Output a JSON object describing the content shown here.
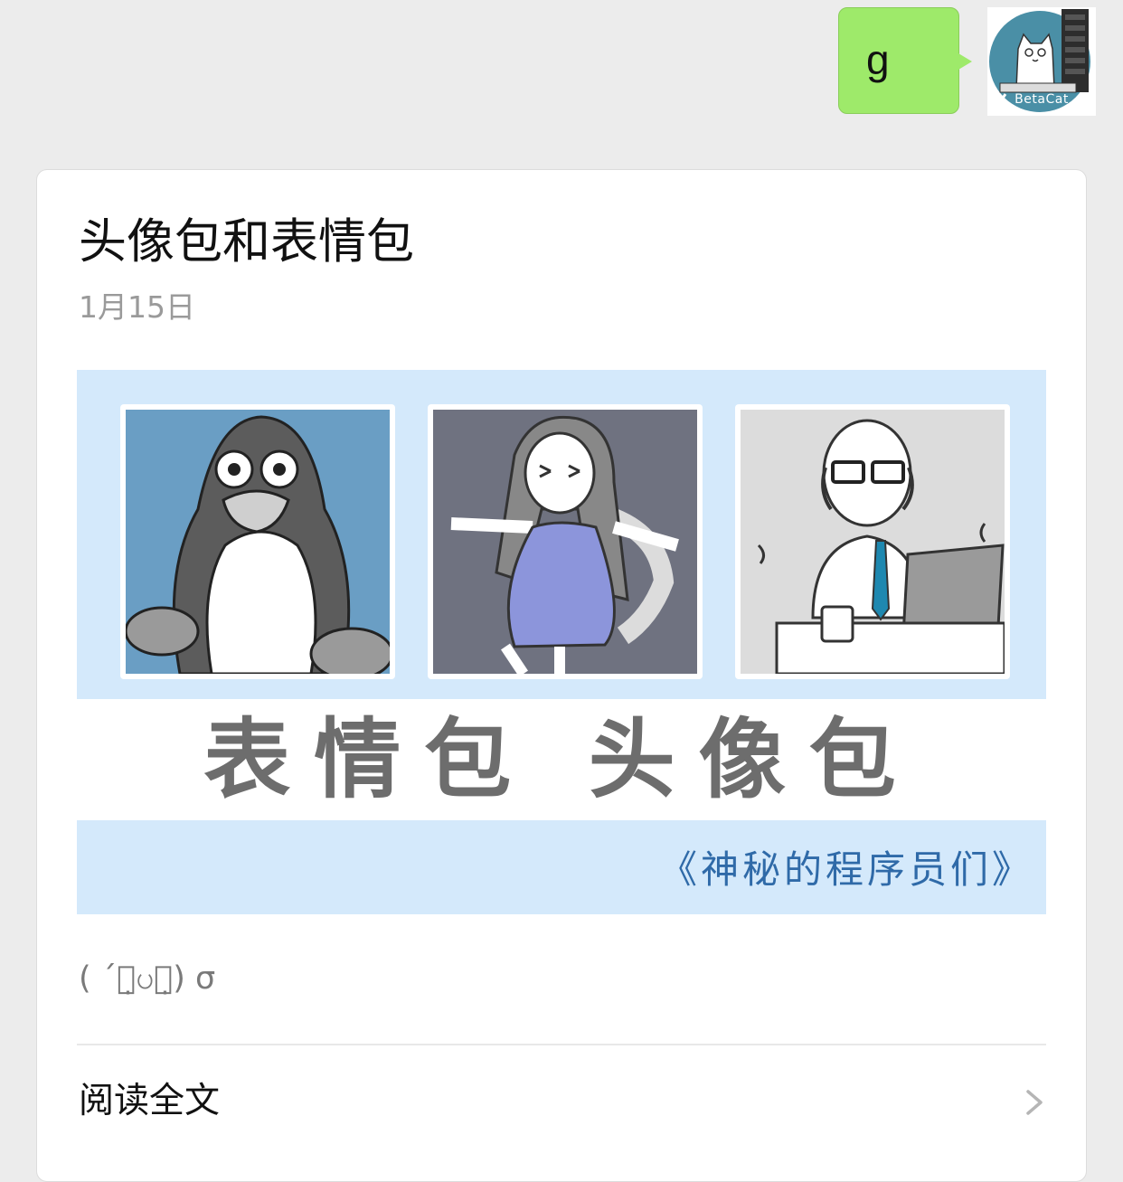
{
  "message": {
    "text": "g",
    "bubble_color": "#9eea6a"
  },
  "avatar": {
    "label": "BetaCat",
    "icon": "betacat-avatar"
  },
  "article": {
    "title": "头像包和表情包",
    "date": "1月15日",
    "cover": {
      "caption": "表情包 头像包",
      "subtitle": "《神秘的程序员们》",
      "panels": [
        "penguin-character",
        "girl-stretching-on-chair",
        "bald-programmer-at-laptop"
      ],
      "background_color": "#d4e9fb"
    },
    "digest": "( ´ထ̣ပထ̣) σ",
    "read_more_label": "阅读全文",
    "read_more_icon": "chevron-right-icon"
  }
}
